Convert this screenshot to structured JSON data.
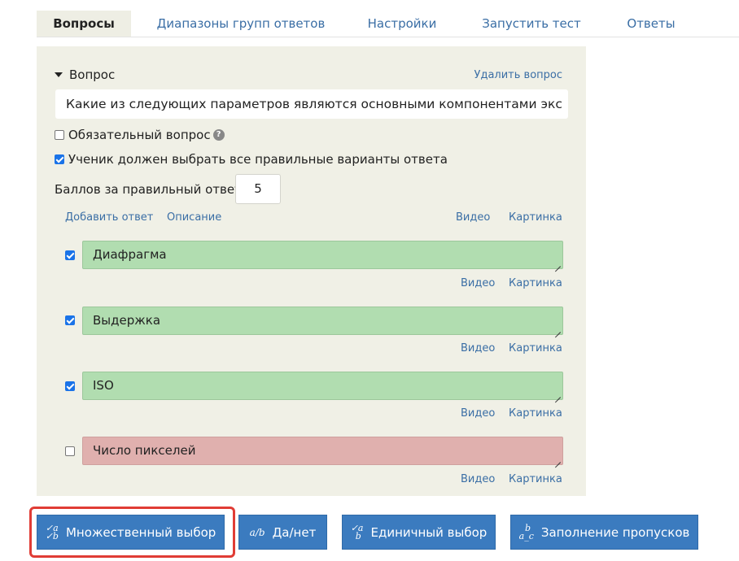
{
  "tabs": [
    {
      "label": "Вопросы",
      "active": true
    },
    {
      "label": "Диапазоны групп ответов",
      "active": false
    },
    {
      "label": "Настройки",
      "active": false
    },
    {
      "label": "Запустить тест",
      "active": false
    },
    {
      "label": "Ответы",
      "active": false
    }
  ],
  "question": {
    "header": "Вопрос",
    "delete_label": "Удалить вопрос",
    "text": "Какие из следующих параметров являются основными компонентами экс",
    "required_label": "Обязательный вопрос",
    "required_checked": false,
    "help_icon": "question-circle-icon",
    "all_correct_label": "Ученик должен выбрать все правильные варианты ответа",
    "all_correct_checked": true,
    "score_label": "Баллов за правильный ответ:",
    "score_value": "5",
    "add_answer_label": "Добавить ответ",
    "description_label": "Описание",
    "video_label": "Видео",
    "picture_label": "Картинка"
  },
  "answers": [
    {
      "text": "Диафрагма",
      "checked": true,
      "video_label": "Видео",
      "picture_label": "Картинка"
    },
    {
      "text": "Выдержка",
      "checked": true,
      "video_label": "Видео",
      "picture_label": "Картинка"
    },
    {
      "text": "ISO",
      "checked": true,
      "video_label": "Видео",
      "picture_label": "Картинка"
    },
    {
      "text": "Число пикселей",
      "checked": false,
      "video_label": "Видео",
      "picture_label": "Картинка"
    }
  ],
  "type_buttons": [
    {
      "label": "Множественный выбор",
      "icon": "multiple-choice-icon",
      "selected": true
    },
    {
      "label": "Да/нет",
      "icon": "yes-no-icon",
      "selected": false
    },
    {
      "label": "Единичный выбор",
      "icon": "single-choice-icon",
      "selected": false
    },
    {
      "label": "Заполнение пропусков",
      "icon": "fill-blanks-icon",
      "selected": false
    }
  ],
  "colors": {
    "accent": "#3b7bbf",
    "correct": "#b1ddb0",
    "wrong": "#e0b0ae",
    "panel": "#f0f0e6",
    "highlight": "#e03c35"
  }
}
